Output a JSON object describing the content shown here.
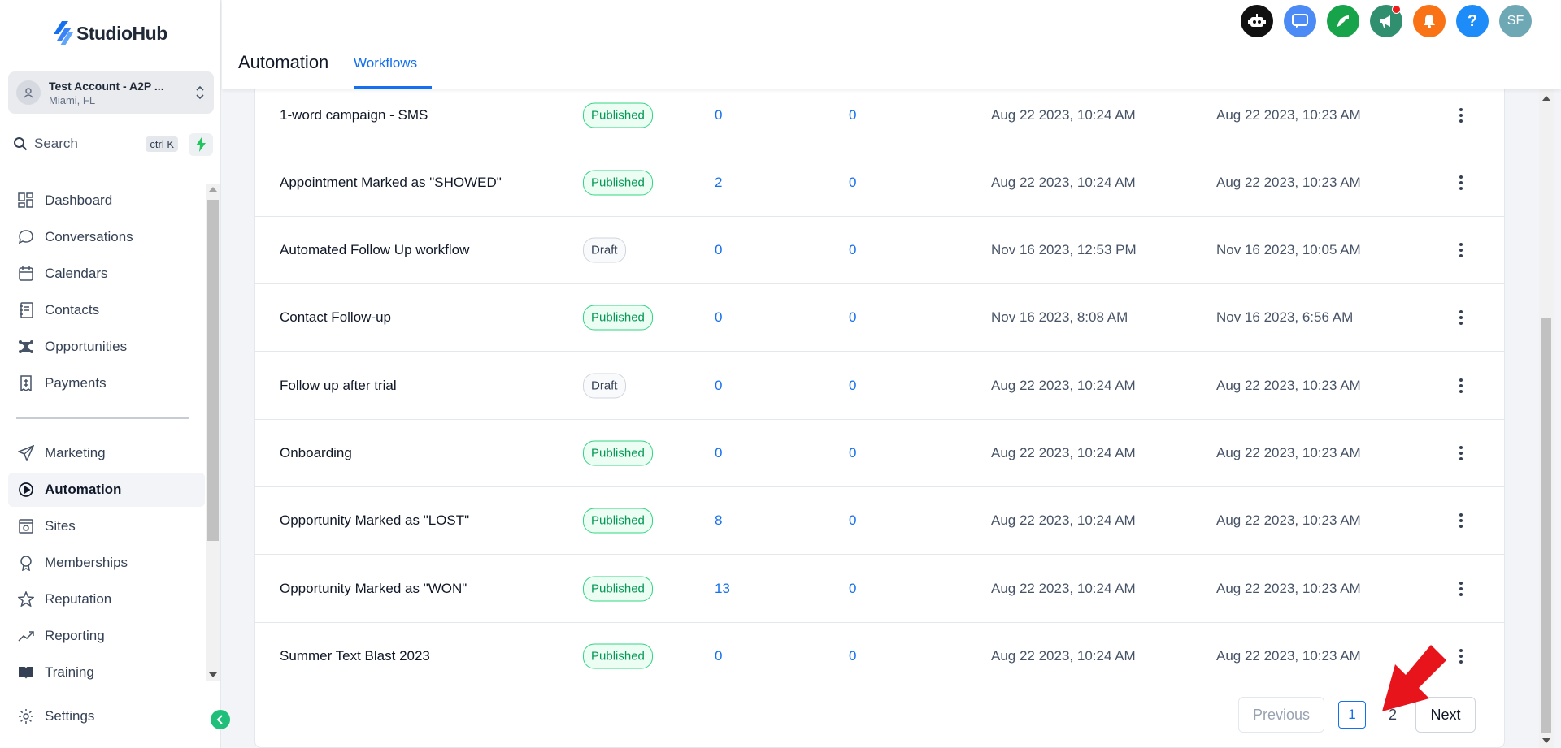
{
  "brand": {
    "name": "StudioHub"
  },
  "account": {
    "name": "Test Account - A2P ...",
    "location": "Miami, FL"
  },
  "search": {
    "label": "Search",
    "shortcut": "ctrl K"
  },
  "sidebar": {
    "items": [
      {
        "label": "Dashboard",
        "icon": "dashboard-icon"
      },
      {
        "label": "Conversations",
        "icon": "chat-bubble-icon"
      },
      {
        "label": "Calendars",
        "icon": "calendar-icon"
      },
      {
        "label": "Contacts",
        "icon": "contact-book-icon"
      },
      {
        "label": "Opportunities",
        "icon": "network-icon"
      },
      {
        "label": "Payments",
        "icon": "receipt-icon"
      },
      {
        "label": "Marketing",
        "icon": "send-icon"
      },
      {
        "label": "Automation",
        "icon": "automation-icon",
        "active": true
      },
      {
        "label": "Sites",
        "icon": "globe-icon"
      },
      {
        "label": "Memberships",
        "icon": "award-icon"
      },
      {
        "label": "Reputation",
        "icon": "star-icon"
      },
      {
        "label": "Reporting",
        "icon": "trending-icon"
      },
      {
        "label": "Training",
        "icon": "book-icon"
      }
    ],
    "settings_label": "Settings"
  },
  "header": {
    "title": "Automation",
    "tabs": [
      {
        "label": "Workflows",
        "active": true
      }
    ],
    "icons": [
      {
        "name": "robot-icon",
        "color": "#111111"
      },
      {
        "name": "chat-icon",
        "color": "#4c8bf5"
      },
      {
        "name": "phone-icon",
        "color": "#16a34a"
      },
      {
        "name": "megaphone-icon",
        "color": "#2f8f6e"
      },
      {
        "name": "bell-icon",
        "color": "#f97316"
      },
      {
        "name": "help-icon",
        "color": "#1d8cf8",
        "glyph": "?"
      },
      {
        "name": "user-avatar",
        "color": "#6fa8b5",
        "glyph": "SF"
      }
    ]
  },
  "workflows": [
    {
      "name": "1-word campaign - SMS",
      "status": "Published",
      "total": "0",
      "active": "0",
      "updated": "Aug 22 2023, 10:24 AM",
      "created": "Aug 22 2023, 10:23 AM"
    },
    {
      "name": "Appointment Marked as \"SHOWED\"",
      "status": "Published",
      "total": "2",
      "active": "0",
      "updated": "Aug 22 2023, 10:24 AM",
      "created": "Aug 22 2023, 10:23 AM"
    },
    {
      "name": "Automated Follow Up workflow",
      "status": "Draft",
      "total": "0",
      "active": "0",
      "updated": "Nov 16 2023, 12:53 PM",
      "created": "Nov 16 2023, 10:05 AM"
    },
    {
      "name": "Contact Follow-up",
      "status": "Published",
      "total": "0",
      "active": "0",
      "updated": "Nov 16 2023, 8:08 AM",
      "created": "Nov 16 2023, 6:56 AM"
    },
    {
      "name": "Follow up after trial",
      "status": "Draft",
      "total": "0",
      "active": "0",
      "updated": "Aug 22 2023, 10:24 AM",
      "created": "Aug 22 2023, 10:23 AM"
    },
    {
      "name": "Onboarding",
      "status": "Published",
      "total": "0",
      "active": "0",
      "updated": "Aug 22 2023, 10:24 AM",
      "created": "Aug 22 2023, 10:23 AM"
    },
    {
      "name": "Opportunity Marked as \"LOST\"",
      "status": "Published",
      "total": "8",
      "active": "0",
      "updated": "Aug 22 2023, 10:24 AM",
      "created": "Aug 22 2023, 10:23 AM"
    },
    {
      "name": "Opportunity Marked as \"WON\"",
      "status": "Published",
      "total": "13",
      "active": "0",
      "updated": "Aug 22 2023, 10:24 AM",
      "created": "Aug 22 2023, 10:23 AM"
    },
    {
      "name": "Summer Text Blast 2023",
      "status": "Published",
      "total": "0",
      "active": "0",
      "updated": "Aug 22 2023, 10:24 AM",
      "created": "Aug 22 2023, 10:23 AM"
    }
  ],
  "pagination": {
    "previous": "Previous",
    "pages": [
      "1",
      "2"
    ],
    "current": "1",
    "next": "Next"
  },
  "colors": {
    "accent": "#1570ef",
    "published": "#039855",
    "annotation_arrow": "#e8141b",
    "active_nav_bg": "#f2f4f7"
  }
}
